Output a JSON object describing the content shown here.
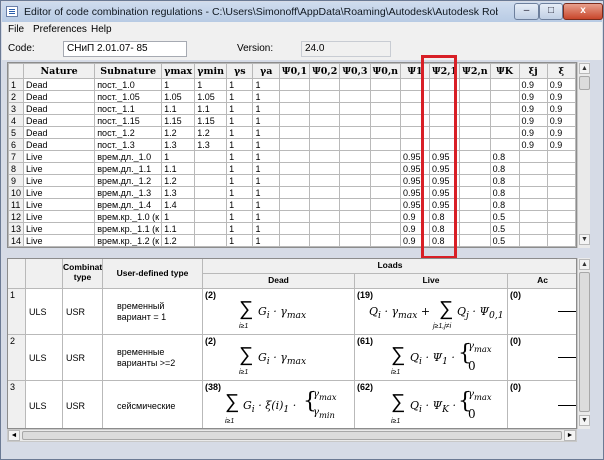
{
  "window": {
    "title": "Editor of code combination regulations - C:\\Users\\Simonoff\\AppData\\Roaming\\Autodesk\\Autodesk Robot Structural Analys...",
    "min_label": "–",
    "max_label": "□",
    "close_label": "x"
  },
  "menu": {
    "file": "File",
    "preferences": "Preferences",
    "help": "Help"
  },
  "form": {
    "code_label": "Code:",
    "code_value": "СНиП 2.01.07- 85",
    "version_label": "Version:",
    "version_value": "24.0"
  },
  "grid1": {
    "headers": [
      "",
      "Nature",
      "Subnature",
      "γmax",
      "γmin",
      "γs",
      "γa",
      "Ψ0,1",
      "Ψ0,2",
      "Ψ0,3",
      "Ψ0,n",
      "Ψ1",
      "Ψ2,1",
      "Ψ2,n",
      "ΨK",
      "ξj",
      "ξ"
    ],
    "rows": [
      [
        "1",
        "Dead",
        "пост._1.0",
        "1",
        "1",
        "1",
        "1",
        "",
        "",
        "",
        "",
        "",
        "",
        "",
        "",
        "0.9",
        "0.9"
      ],
      [
        "2",
        "Dead",
        "пост._1.05",
        "1.05",
        "1.05",
        "1",
        "1",
        "",
        "",
        "",
        "",
        "",
        "",
        "",
        "",
        "0.9",
        "0.9"
      ],
      [
        "3",
        "Dead",
        "пост._1.1",
        "1.1",
        "1.1",
        "1",
        "1",
        "",
        "",
        "",
        "",
        "",
        "",
        "",
        "",
        "0.9",
        "0.9"
      ],
      [
        "4",
        "Dead",
        "пост._1.15",
        "1.15",
        "1.15",
        "1",
        "1",
        "",
        "",
        "",
        "",
        "",
        "",
        "",
        "",
        "0.9",
        "0.9"
      ],
      [
        "5",
        "Dead",
        "пост._1.2",
        "1.2",
        "1.2",
        "1",
        "1",
        "",
        "",
        "",
        "",
        "",
        "",
        "",
        "",
        "0.9",
        "0.9"
      ],
      [
        "6",
        "Dead",
        "пост._1.3",
        "1.3",
        "1.3",
        "1",
        "1",
        "",
        "",
        "",
        "",
        "",
        "",
        "",
        "",
        "0.9",
        "0.9"
      ],
      [
        "7",
        "Live",
        "врем.дл._1.0",
        "1",
        "",
        "1",
        "1",
        "",
        "",
        "",
        "",
        "0.95",
        "0.95",
        "",
        "0.8",
        "",
        ""
      ],
      [
        "8",
        "Live",
        "врем.дл._1.1",
        "1.1",
        "",
        "1",
        "1",
        "",
        "",
        "",
        "",
        "0.95",
        "0.95",
        "",
        "0.8",
        "",
        ""
      ],
      [
        "9",
        "Live",
        "врем.дл._1.2",
        "1.2",
        "",
        "1",
        "1",
        "",
        "",
        "",
        "",
        "0.95",
        "0.95",
        "",
        "0.8",
        "",
        ""
      ],
      [
        "10",
        "Live",
        "врем.дл._1.3",
        "1.3",
        "",
        "1",
        "1",
        "",
        "",
        "",
        "",
        "0.95",
        "0.95",
        "",
        "0.8",
        "",
        ""
      ],
      [
        "11",
        "Live",
        "врем.дл._1.4",
        "1.4",
        "",
        "1",
        "1",
        "",
        "",
        "",
        "",
        "0.95",
        "0.95",
        "",
        "0.8",
        "",
        ""
      ],
      [
        "12",
        "Live",
        "врем.кр._1.0 (к",
        "1",
        "",
        "1",
        "1",
        "",
        "",
        "",
        "",
        "0.9",
        "0.8",
        "",
        "0.5",
        "",
        ""
      ],
      [
        "13",
        "Live",
        "врем.кр._1.1 (к",
        "1.1",
        "",
        "1",
        "1",
        "",
        "",
        "",
        "",
        "0.9",
        "0.8",
        "",
        "0.5",
        "",
        ""
      ],
      [
        "14",
        "Live",
        "врем.кр._1.2 (к",
        "1.2",
        "",
        "1",
        "1",
        "",
        "",
        "",
        "",
        "0.9",
        "0.8",
        "",
        "0.5",
        "",
        ""
      ],
      [
        "15",
        "Live",
        "врем.кр._1.3 (к",
        "1.3",
        "",
        "1",
        "1",
        "",
        "",
        "",
        "",
        "0.9",
        "0.8",
        "",
        "0.5",
        "",
        ""
      ]
    ]
  },
  "grid2": {
    "header_loads": "Loads",
    "header_combination": "Combination type",
    "header_userdef": "User-defined type",
    "header_dead": "Dead",
    "header_live": "Live",
    "header_accidental": "Ac",
    "rows": [
      {
        "num": "1",
        "comb": "ULS",
        "src": "USR",
        "desc": "временный вариант = 1",
        "dead_id": "(2)",
        "live_id": "(19)",
        "acc_id": "(0)"
      },
      {
        "num": "2",
        "comb": "ULS",
        "src": "USR",
        "desc": "временные варианты >=2",
        "dead_id": "(2)",
        "live_id": "(61)",
        "acc_id": "(0)"
      },
      {
        "num": "3",
        "comb": "ULS",
        "src": "USR",
        "desc": "сейсмические",
        "dead_id": "(38)",
        "live_id": "(62)",
        "acc_id": "(0)"
      }
    ]
  }
}
